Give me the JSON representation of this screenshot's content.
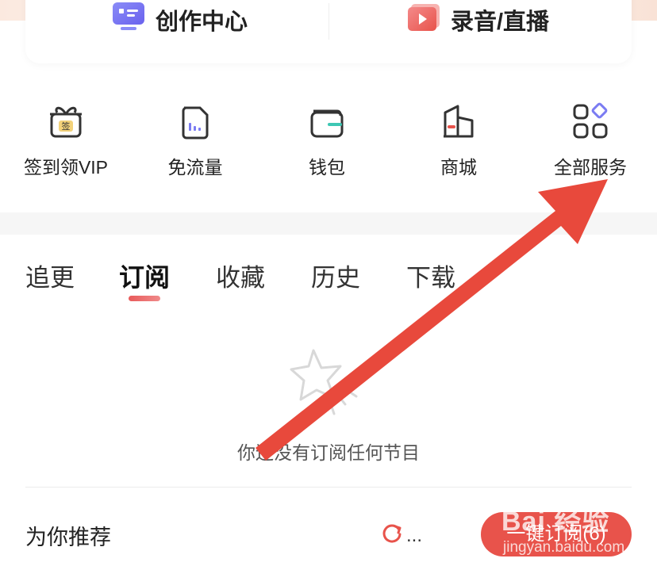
{
  "creator_card": {
    "left_label": "创作中心",
    "right_label": "录音/直播"
  },
  "quick_actions": [
    {
      "label": "签到领VIP",
      "icon": "gift-sign-icon",
      "badge": "签"
    },
    {
      "label": "免流量",
      "icon": "data-sim-icon"
    },
    {
      "label": "钱包",
      "icon": "wallet-icon"
    },
    {
      "label": "商城",
      "icon": "mall-icon"
    },
    {
      "label": "全部服务",
      "icon": "all-services-grid-icon"
    }
  ],
  "tabs": {
    "items": [
      "追更",
      "订阅",
      "收藏",
      "历史",
      "下载"
    ],
    "active": "订阅"
  },
  "empty_state": {
    "icon": "star-empty-icon",
    "message": "你还没有订阅任何节目"
  },
  "recommend": {
    "title": "为你推荐",
    "refresh_label": "...",
    "subscribe_button": "一键订阅(6)"
  },
  "watermark": {
    "main": "Bai 经验",
    "sub": "jingyan.baidu.com"
  },
  "colors": {
    "accent": "#e8534b",
    "arrow": "#e8493c"
  }
}
